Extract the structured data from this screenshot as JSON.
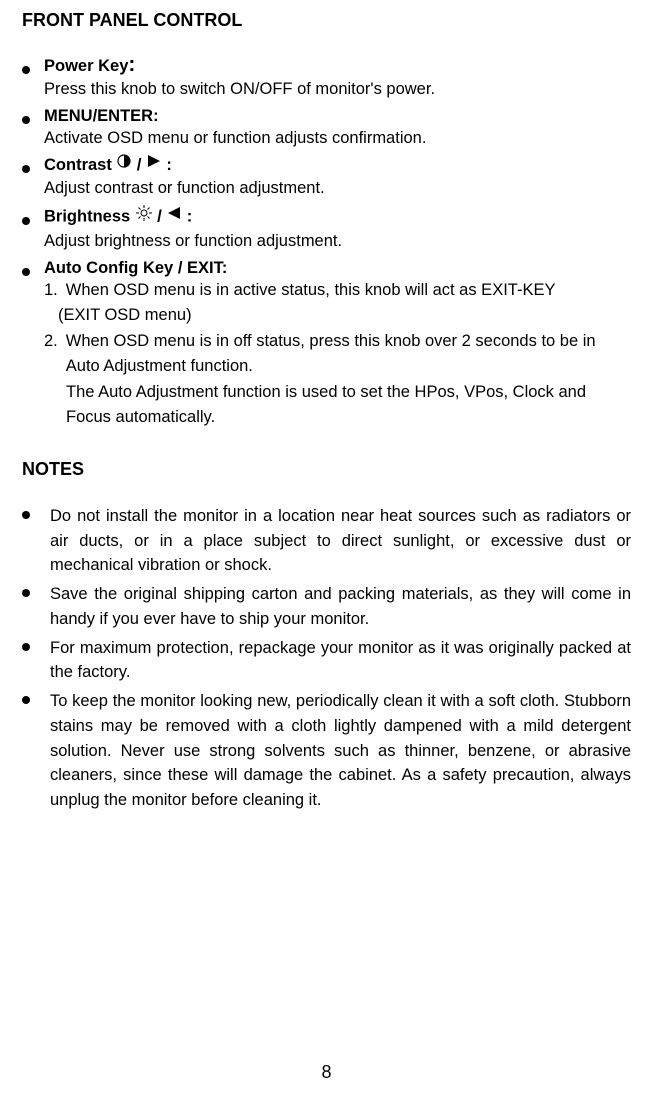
{
  "sectionTitle": "FRONT PANEL CONTROL",
  "items": {
    "power": {
      "title": "Power Key",
      "body": "Press this knob to switch ON/OFF of monitor's power."
    },
    "menu": {
      "title": "MENU/ENTER:",
      "body": "Activate OSD menu or function adjusts confirmation."
    },
    "contrast": {
      "title": "Contrast",
      "body": "Adjust contrast or function adjustment."
    },
    "brightness": {
      "title": "Brightness",
      "body": "Adjust brightness or function adjustment."
    },
    "auto": {
      "title": "Auto Config Key / EXIT:",
      "n1": "1.",
      "t1a": "When OSD menu is in active status, this knob will act as EXIT-KEY",
      "t1b": "(EXIT OSD menu)",
      "n2": "2.",
      "t2": "When OSD menu is in off status, press this knob over 2 seconds to  be in Auto Adjustment function.",
      "t3": "The Auto Adjustment function is used to set the HPos, VPos, Clock and Focus automatically."
    }
  },
  "notesTitle": "NOTES",
  "notes": {
    "n1": "Do not install the monitor in a location near heat sources such as radiators or air ducts, or in a place subject to direct sunlight, or excessive dust or mechanical vibration or shock.",
    "n2": "Save the original shipping carton and packing materials, as they will come in handy if you ever have to ship your monitor.",
    "n3": "For maximum protection, repackage your monitor as it was originally packed at the factory.",
    "n4": "To keep the monitor looking new, periodically clean it with a soft cloth.  Stubborn stains may be removed with a cloth lightly dampened with a mild detergent solution. Never use strong solvents such as thinner, benzene, or abrasive cleaners, since these will damage the cabinet. As a safety precaution, always unplug the monitor before cleaning it."
  },
  "pageNumber": "8",
  "glyphs": {
    "slash": "/",
    "colon": ":"
  }
}
